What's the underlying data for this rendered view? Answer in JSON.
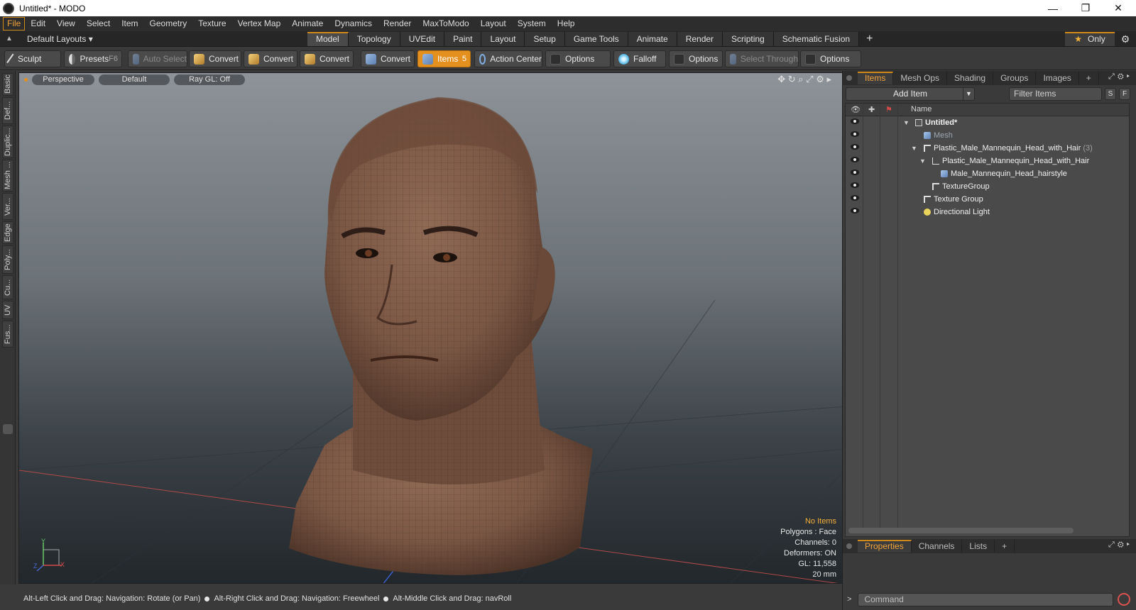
{
  "window": {
    "title": "Untitled* - MODO",
    "minimize_glyph": "—",
    "restore_glyph": "❐",
    "close_glyph": "✕"
  },
  "menu": [
    "File",
    "Edit",
    "View",
    "Select",
    "Item",
    "Geometry",
    "Texture",
    "Vertex Map",
    "Animate",
    "Dynamics",
    "Render",
    "MaxToModo",
    "Layout",
    "System",
    "Help"
  ],
  "layout_bar": {
    "selector": "Default Layouts ▾",
    "tabs": [
      "Model",
      "Topology",
      "UVEdit",
      "Paint",
      "Layout",
      "Setup",
      "Game Tools",
      "Animate",
      "Render",
      "Scripting",
      "Schematic Fusion"
    ],
    "active_tab": "Model",
    "add_glyph": "+",
    "only_label": "Only",
    "gear_glyph": "⚙"
  },
  "toolbar": {
    "sculpt": "Sculpt",
    "presets": "Presets",
    "presets_key": "F6",
    "auto_select": "Auto Select",
    "convert1": "Convert",
    "convert2": "Convert",
    "convert3": "Convert",
    "convert4": "Convert",
    "items": "Items",
    "items_key": "5",
    "action_center": "Action Center",
    "options1": "Options",
    "falloff": "Falloff",
    "options2": "Options",
    "select_through": "Select Through",
    "options3": "Options"
  },
  "left_tabs": [
    "Basic",
    "Def...",
    "Duplic...",
    "Mesh ...",
    "Ver...",
    "Edge",
    "Poly...",
    "Cu...",
    "UV",
    "Fus..."
  ],
  "viewport": {
    "view": "Perspective",
    "shading": "Default",
    "raygl": "Ray GL: Off",
    "tools": "✥ ↻ ⌕ ⤢ ⚙ ▸",
    "info": {
      "no_items": "No Items",
      "polygons": "Polygons : Face",
      "channels": "Channels: 0",
      "deformers": "Deformers: ON",
      "gl": "GL: 11,558",
      "scale": "20 mm"
    },
    "axis_labels": {
      "y": "Y",
      "x": "X",
      "z": "Z"
    }
  },
  "statusbar": {
    "hint1": "Alt-Left Click and Drag: Navigation: Rotate (or Pan)",
    "hint2": "Alt-Right Click and Drag: Navigation: Freewheel",
    "hint3": "Alt-Middle Click and Drag: navRoll"
  },
  "right_panel": {
    "tabs": [
      "Items",
      "Mesh Ops",
      "Shading",
      "Groups",
      "Images"
    ],
    "active_tab": "Items",
    "add_tab": "+",
    "add_item": "Add Item",
    "filter_placeholder": "Filter Items",
    "s_btn": "S",
    "f_btn": "F",
    "name_col": "Name",
    "tree": [
      {
        "label": "Untitled*",
        "kind": "scene"
      },
      {
        "label": "Mesh",
        "kind": "mesh"
      },
      {
        "label": "Plastic_Male_Mannequin_Head_with_Hair",
        "count": "(3)",
        "kind": "group"
      },
      {
        "label": "Plastic_Male_Mannequin_Head_with_Hair",
        "kind": "locator"
      },
      {
        "label": "Male_Mannequin_Head_hairstyle",
        "kind": "mesh"
      },
      {
        "label": "TextureGroup",
        "kind": "group"
      },
      {
        "label": "Texture Group",
        "kind": "group"
      },
      {
        "label": "Directional Light",
        "kind": "light"
      }
    ],
    "bottom_tabs": [
      "Properties",
      "Channels",
      "Lists"
    ],
    "bottom_active": "Properties",
    "command_placeholder": "Command",
    "command_arrow": ">"
  }
}
